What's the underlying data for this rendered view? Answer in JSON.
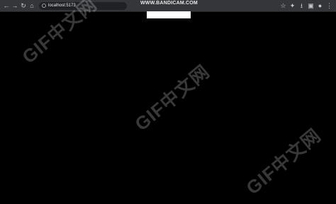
{
  "browser": {
    "back_icon": "←",
    "forward_icon": "→",
    "reload_icon": "↻",
    "home_icon": "⌂",
    "url": "localhost:5173",
    "bookmark_icon": "☆",
    "extensions_icon": "✦",
    "download_icon": "⭳",
    "sidepanel_icon": "▣",
    "profile_icon": "●",
    "menu_icon": "⋮"
  },
  "recording_watermark": "WWW.BANDICAM.COM",
  "overlay_watermark": "GIF中文网"
}
